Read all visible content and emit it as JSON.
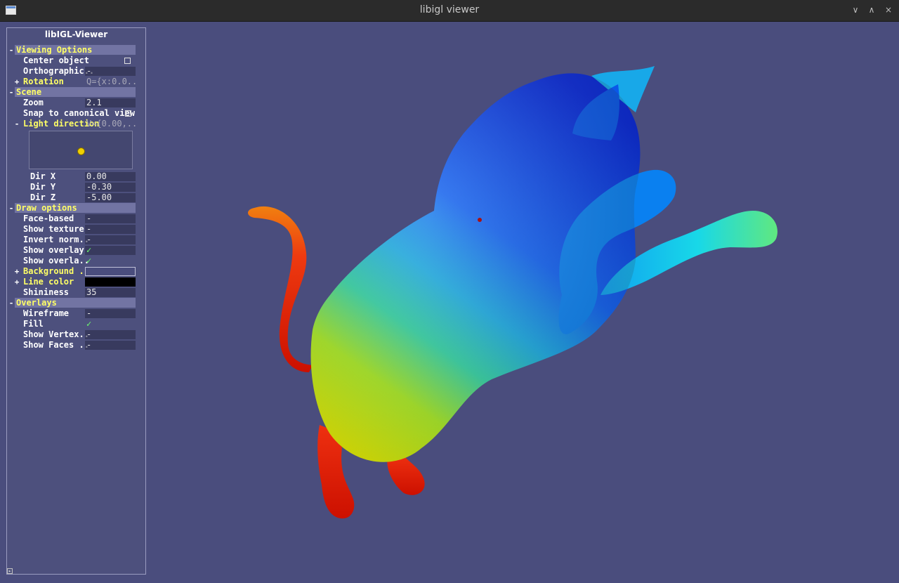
{
  "window": {
    "title": "libigl viewer",
    "controls": [
      "∨",
      "∧",
      "×"
    ]
  },
  "colors": {
    "background": "#4a4d7d",
    "line_color": "#000000",
    "accent_group": "#ffff66"
  },
  "panel": {
    "title": "libIGL-Viewer",
    "viewing_options": {
      "label": "Viewing Options",
      "center_object": "Center object",
      "orthographic": "Orthographic..",
      "orthographic_value": "-",
      "rotation": "Rotation",
      "rotation_value": "Q={x:0.0.."
    },
    "scene": {
      "label": "Scene",
      "zoom": "Zoom",
      "zoom_value": "2.1",
      "snap": "Snap to canonical view",
      "light_direction": "Light direction",
      "light_direction_value": "V={0.00,..",
      "dir_x": "Dir X",
      "dir_x_value": "0.00",
      "dir_y": "Dir Y",
      "dir_y_value": "-0.30",
      "dir_z": "Dir Z",
      "dir_z_value": "-5.00"
    },
    "draw_options": {
      "label": "Draw options",
      "face_based": "Face-based",
      "face_based_value": "-",
      "show_texture": "Show texture",
      "show_texture_value": "-",
      "invert_normals": "Invert norm..",
      "invert_normals_value": "-",
      "show_overlay": "Show overlay",
      "show_overlay_depth": "Show overla..",
      "background": "Background ..",
      "line_color": "Line color",
      "shininess": "Shininess",
      "shininess_value": "35"
    },
    "overlays": {
      "label": "Overlays",
      "wireframe": "Wireframe",
      "wireframe_value": "-",
      "fill": "Fill",
      "show_vertex": "Show Vertex..",
      "show_vertex_value": "-",
      "show_faces": "Show Faces ..",
      "show_faces_value": "-"
    },
    "expand_minus": "-",
    "expand_plus": "+",
    "check": "✓"
  },
  "icons": [
    "window-app-icon",
    "minimize-icon",
    "maximize-icon",
    "close-icon",
    "checkbox-icon",
    "light-ball-icon",
    "resize-corner-icon"
  ]
}
